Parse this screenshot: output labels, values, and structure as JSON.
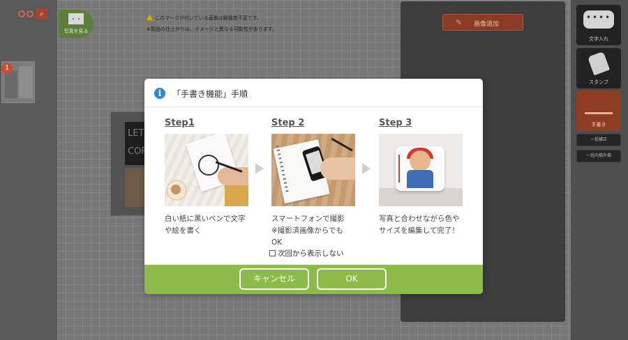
{
  "editor": {
    "photo_button_label": "写真を見る",
    "notice_line1": "このマークが付いている画像は解像度不足です。",
    "notice_line2": "※製品の仕上がりは、イメージと異なる可能性があります。",
    "add_image_label": "画像追加",
    "thumb_badge": "1",
    "product_text": "LET COF"
  },
  "tools": [
    {
      "label": "文字入れ",
      "icon": "speech-bubble-icon",
      "active": false
    },
    {
      "label": "スタンプ",
      "icon": "stamp-icon",
      "active": false
    },
    {
      "label": "手書き",
      "icon": "handwriting-icon",
      "active": true
    }
  ],
  "tool_buttons": [
    "一括補正",
    "一括内揃外揃"
  ],
  "dialog": {
    "title": "「手書き機能」手順",
    "steps": [
      {
        "title": "Step1",
        "desc_lines": [
          "白い紙に黒いペンで文字",
          "や絵を書く"
        ]
      },
      {
        "title": "Step 2",
        "desc_lines": [
          "スマートフォンで撮影",
          "※撮影済画像からでも",
          "OK"
        ]
      },
      {
        "title": "Step 3",
        "desc_lines": [
          "写真と合わせながら色や",
          "サイズを編集して完了！"
        ]
      }
    ],
    "checkbox_label": "次回から表示しない",
    "cancel_label": "キャンセル",
    "ok_label": "OK"
  },
  "colors": {
    "footer_green": "#8cbb4a",
    "info_blue": "#2b8ad6",
    "active_tool": "#8e3d22"
  }
}
